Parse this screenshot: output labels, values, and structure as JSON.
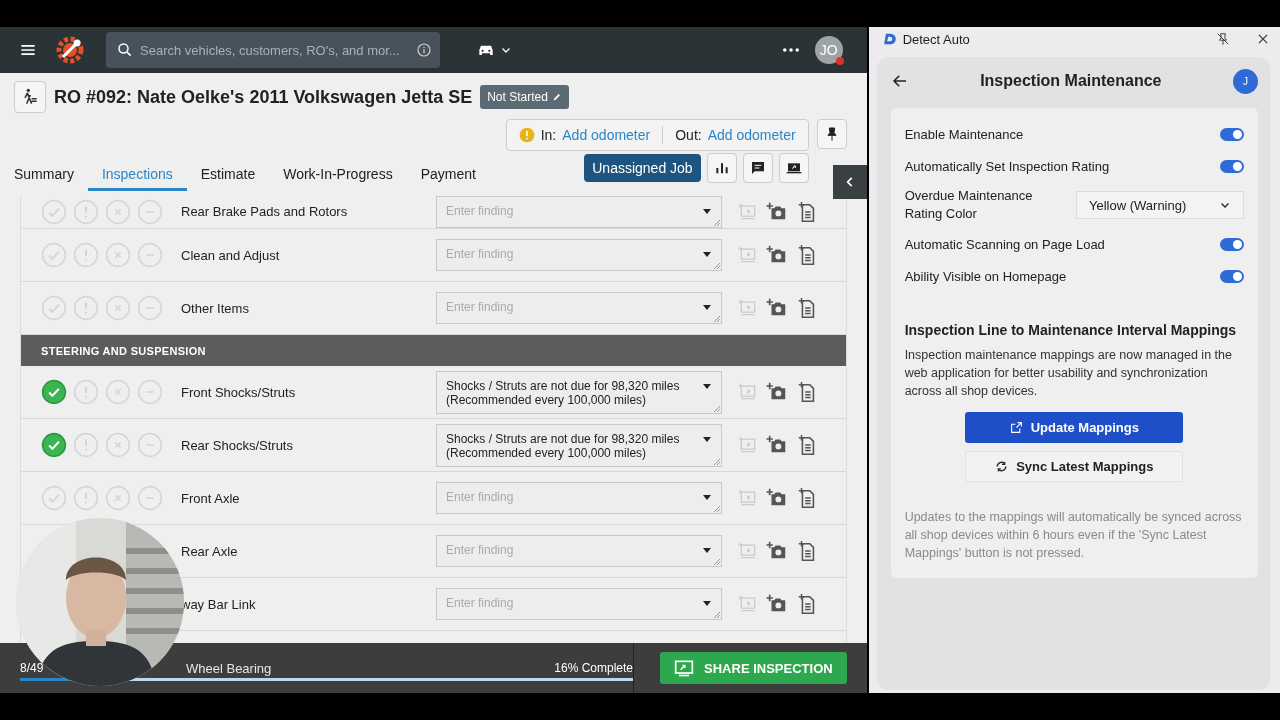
{
  "topbar": {
    "search_placeholder": "Search vehicles, customers, RO's, and mor...",
    "avatar": "JO"
  },
  "ro": {
    "title": "RO #092: Nate Oelke's 2011 Volkswagen Jetta SE",
    "status": "Not Started",
    "in_label": "In:",
    "in_link": "Add odometer",
    "out_label": "Out:",
    "out_link": "Add odometer",
    "job_button": "Unassigned Job"
  },
  "tabs": [
    {
      "label": "Summary",
      "selected": false
    },
    {
      "label": "Inspections",
      "selected": true
    },
    {
      "label": "Estimate",
      "selected": false
    },
    {
      "label": "Work-In-Progress",
      "selected": false
    },
    {
      "label": "Payment",
      "selected": false
    }
  ],
  "rows": [
    {
      "kind": "item",
      "label": "Rear Brake Pads and Rotors",
      "passed": false,
      "placeholder": "Enter finding"
    },
    {
      "kind": "item",
      "label": "Clean and Adjust",
      "passed": false,
      "placeholder": "Enter finding"
    },
    {
      "kind": "item",
      "label": "Other Items",
      "passed": false,
      "placeholder": "Enter finding"
    },
    {
      "kind": "section",
      "label": "STEERING AND SUSPENSION"
    },
    {
      "kind": "item",
      "label": "Front Shocks/Struts",
      "passed": true,
      "value": "Shocks / Struts are not due for 98,320 miles\n(Recommended every 100,000 miles)"
    },
    {
      "kind": "item",
      "label": "Rear Shocks/Struts",
      "passed": true,
      "value": "Shocks / Struts are not due for 98,320 miles\n(Recommended every 100,000 miles)"
    },
    {
      "kind": "item",
      "label": "Front Axle",
      "passed": false,
      "placeholder": "Enter finding"
    },
    {
      "kind": "item",
      "label": "Rear Axle",
      "placeholder": "Enter finding"
    },
    {
      "kind": "item",
      "label": "way Bar Link",
      "placeholder": "Enter finding"
    }
  ],
  "status_bar": {
    "count": "8/49",
    "partial_row": "Wheel Bearing",
    "complete": "16% Complete",
    "level": 0.16,
    "share": "SHARE INSPECTION"
  },
  "panel": {
    "app": "Detect Auto",
    "title": "Inspection Maintenance",
    "avatar": "J",
    "settings": [
      {
        "kind": "toggle",
        "label": "Enable Maintenance",
        "on": true
      },
      {
        "kind": "toggle",
        "label": "Automatically Set Inspection Rating",
        "on": true
      },
      {
        "kind": "select",
        "label": "Overdue Maintenance Rating Color",
        "value": "Yellow (Warning)"
      },
      {
        "kind": "toggle",
        "label": "Automatic Scanning on Page Load",
        "on": true
      },
      {
        "kind": "toggle",
        "label": "Ability Visible on Homepage",
        "on": true
      }
    ],
    "section_title": "Inspection Line to Maintenance Interval Mappings",
    "description": "Inspection maintenance mappings are now managed in the web application for better usability and synchronization across all shop devices.",
    "update_button": "Update Mappings",
    "sync_button": "Sync Latest Mappings",
    "note": "Updates to the mappings will automatically be synced across all shop devices within 6 hours even if the 'Sync Latest Mappings' button is not pressed."
  }
}
